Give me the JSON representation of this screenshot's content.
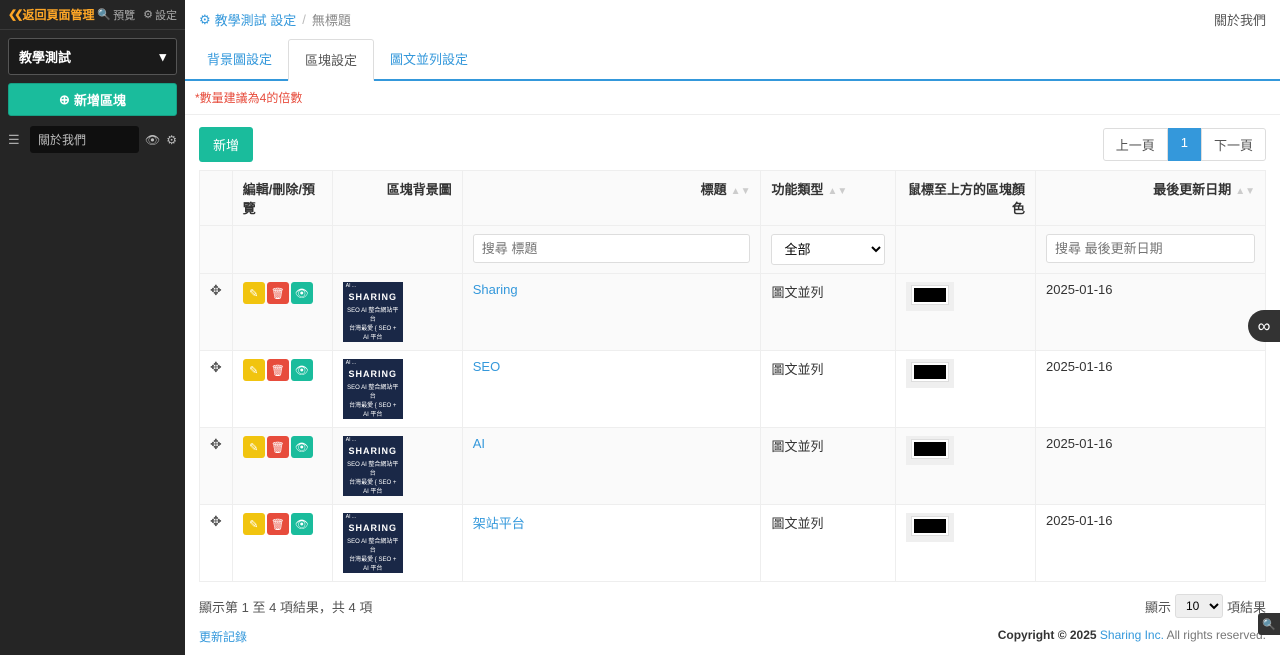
{
  "sidebar": {
    "back": "返回頁面管理",
    "preview": "預覽",
    "settings": "設定",
    "select": "教學測試",
    "add_block": "新增區塊",
    "item": "關於我們"
  },
  "crumb": {
    "page": "教學測試 設定",
    "current": "無標題",
    "about": "關於我們"
  },
  "tabs": [
    "背景圖設定",
    "區塊設定",
    "圖文並列設定"
  ],
  "hint": "*數量建議為4的倍數",
  "btn_new": "新增",
  "pager": {
    "prev": "上一頁",
    "page1": "1",
    "next": "下一頁"
  },
  "columns": {
    "edit": "編輯/刪除/預覽",
    "bg": "區塊背景圖",
    "title": "標題",
    "func": "功能類型",
    "hover": "鼠標至上方的區塊顏色",
    "date": "最後更新日期"
  },
  "search": {
    "title_ph": "搜尋 標題",
    "func_sel": "全部",
    "date_ph": "搜尋 最後更新日期"
  },
  "thumb": {
    "top": "AI ...",
    "big": "SHARING",
    "l1": "SEO AI 整合網站平台",
    "l2": "台灣最愛 { SEO + AI 平台"
  },
  "rows": [
    {
      "title": "Sharing",
      "func": "圖文並列",
      "date": "2025-01-16"
    },
    {
      "title": "SEO",
      "func": "圖文並列",
      "date": "2025-01-16"
    },
    {
      "title": "AI",
      "func": "圖文並列",
      "date": "2025-01-16"
    },
    {
      "title": "架站平台",
      "func": "圖文並列",
      "date": "2025-01-16"
    }
  ],
  "info": "顯示第 1 至 4 項結果，共 4 項",
  "length": {
    "pre": "顯示",
    "val": "10",
    "post": "項結果"
  },
  "footer": {
    "log": "更新記錄",
    "copy_pre": "Copyright © 2025 ",
    "brand": "Sharing Inc.",
    "copy_post": " All rights reserved."
  }
}
